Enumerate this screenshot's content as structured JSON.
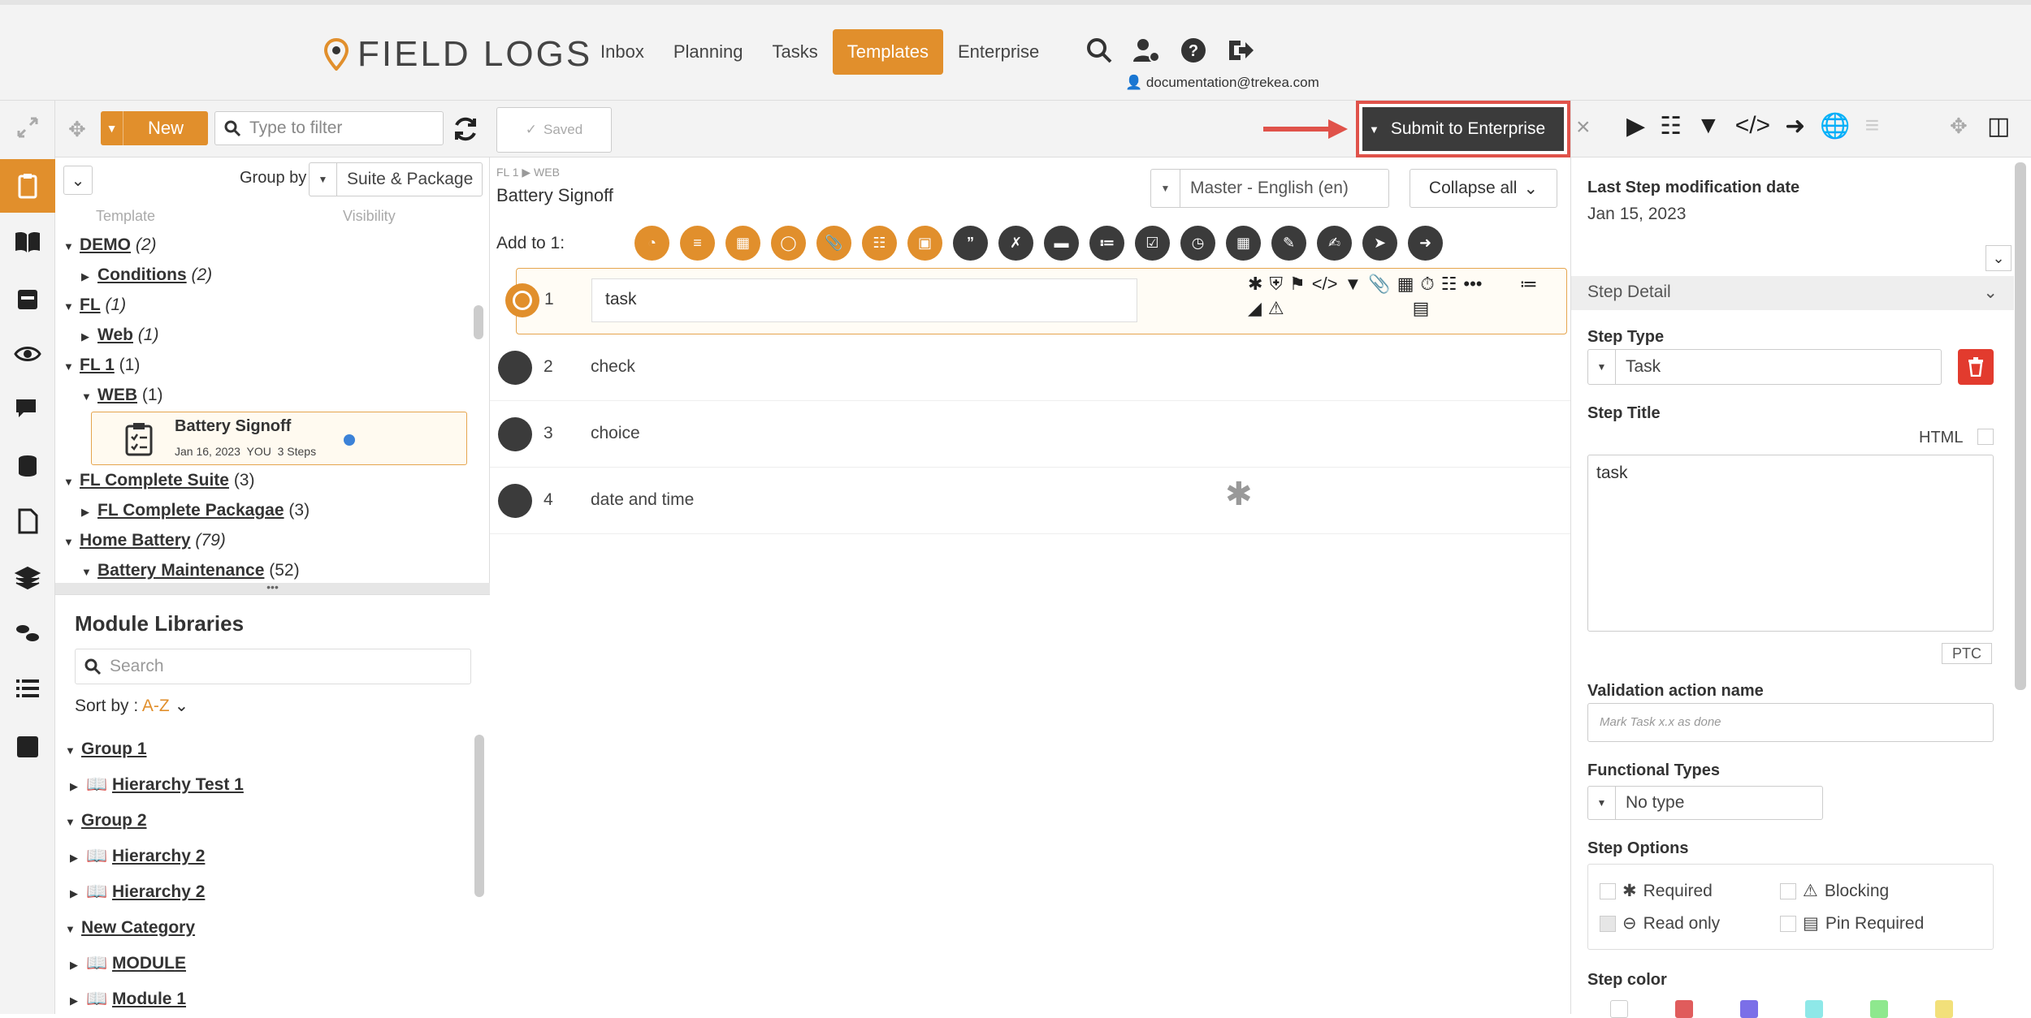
{
  "header": {
    "logo_text": "FIELD LOGS",
    "nav": [
      "Inbox",
      "Planning",
      "Tasks",
      "Templates",
      "Enterprise"
    ],
    "active_nav": "Templates",
    "user_email": "documentation@trekea.com",
    "icons": [
      "search-icon",
      "user-settings-icon",
      "help-icon",
      "logout-icon"
    ]
  },
  "left_toolbar": {
    "new_label": "New",
    "filter_placeholder": "Type to filter",
    "group_by_label": "Group by",
    "group_by_value": "Suite & Package",
    "col_template": "Template",
    "col_visibility": "Visibility"
  },
  "tree": [
    {
      "label": "DEMO",
      "count": "(2)",
      "italic": true,
      "level": 0
    },
    {
      "label": "Conditions",
      "count": "(2)",
      "italic": true,
      "level": 1
    },
    {
      "label": "FL",
      "count": "(1)",
      "italic": true,
      "level": 0
    },
    {
      "label": "Web",
      "count": "(1)",
      "italic": true,
      "level": 1
    },
    {
      "label": "FL 1",
      "count": "(1)",
      "italic": false,
      "level": 0
    },
    {
      "label": "WEB",
      "count": "(1)",
      "italic": false,
      "level": 1
    },
    {
      "label": "FL Complete Suite",
      "count": "(3)",
      "italic": false,
      "level": 0
    },
    {
      "label": "FL Complete Packagae",
      "count": "(3)",
      "italic": false,
      "level": 1
    },
    {
      "label": "Home Battery",
      "count": "(79)",
      "italic": true,
      "level": 0
    },
    {
      "label": "Battery Maintenance",
      "count": "(52)",
      "italic": false,
      "level": 1
    }
  ],
  "selected_template": {
    "title": "Battery Signoff",
    "meta": "Jan 16, 2023  YOU  3 Steps"
  },
  "module_libraries": {
    "title": "Module Libraries",
    "search_placeholder": "Search",
    "sort_label": "Sort by :",
    "sort_value": "A-Z",
    "items": [
      {
        "label": "Group 1",
        "level": 0
      },
      {
        "label": "Hierarchy Test 1",
        "level": 1
      },
      {
        "label": "Group 2",
        "level": 0
      },
      {
        "label": "Hierarchy 2",
        "level": 1
      },
      {
        "label": "Hierarchy 2",
        "level": 1
      },
      {
        "label": "New Category",
        "level": 0
      },
      {
        "label": "MODULE",
        "level": 1
      },
      {
        "label": "Module 1",
        "level": 1
      }
    ]
  },
  "center": {
    "saved_label": "Saved",
    "submit_label": "Submit to Enterprise",
    "breadcrumb": "FL 1 ▶ WEB",
    "template_title": "Battery Signoff",
    "language": "Master - English (en)",
    "collapse_label": "Collapse all",
    "add_to_label": "Add to 1:",
    "steps": [
      {
        "num": "1",
        "title": "task"
      },
      {
        "num": "2",
        "title": "check"
      },
      {
        "num": "3",
        "title": "choice"
      },
      {
        "num": "4",
        "title": "date and time"
      }
    ]
  },
  "right": {
    "last_mod_label": "Last Step modification date",
    "last_mod_value": "Jan 15, 2023",
    "step_detail": "Step Detail",
    "step_type_label": "Step Type",
    "step_type_value": "Task",
    "step_title_label": "Step Title",
    "html_label": "HTML",
    "step_title_value": "task",
    "ptc_label": "PTC",
    "validation_label": "Validation action name",
    "validation_placeholder": "Mark Task x.x as done",
    "functional_label": "Functional Types",
    "functional_value": "No type",
    "options_label": "Step Options",
    "opt_required": "Required",
    "opt_blocking": "Blocking",
    "opt_readonly": "Read only",
    "opt_pin": "Pin Required",
    "color_label": "Step color"
  },
  "colors": {
    "accent": "#e18f2c",
    "dark": "#3b3b3b",
    "danger": "#e23b2e",
    "highlight": "#e0524a"
  }
}
